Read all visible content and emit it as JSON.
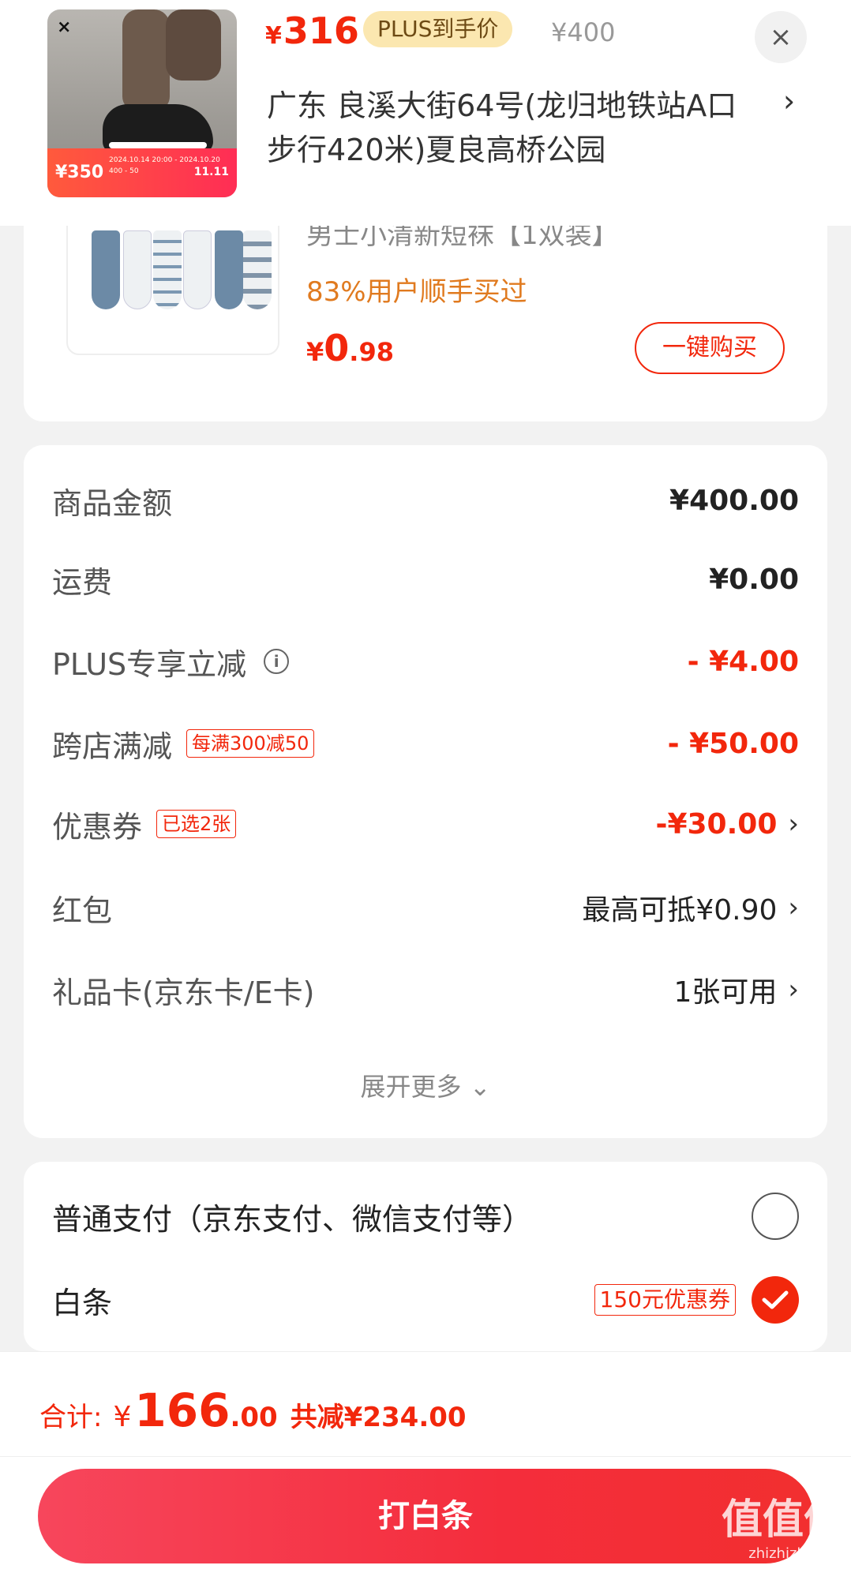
{
  "header": {
    "price_yen": "¥",
    "price_value": "316",
    "plus_tag": "PLUS到手价",
    "original_price": "¥400",
    "close_icon": "×",
    "address": "广东  良溪大街64号(龙归地铁站A口步行420米)夏良高桥公园",
    "address_chevron": "›",
    "thumb": {
      "brand_icon": "under-armour-logo",
      "promo_big": "¥350",
      "promo_mini_1": "2024.10.14 20:00 - 2024.10.20",
      "promo_mini_2": "400 - 50",
      "promo_logo": "11.11"
    }
  },
  "recommendation": {
    "title": "男士小清新短袜【1双装】",
    "subtitle": "83%用户顺手买过",
    "price_yen": "¥",
    "price_int": "0",
    "price_dec": ".98",
    "buy_button": "一键购买"
  },
  "summary": {
    "rows": [
      {
        "label": "商品金额",
        "value": "¥400.00"
      },
      {
        "label": "运费",
        "value": "¥0.00"
      },
      {
        "label": "PLUS专享立减",
        "value": "- ¥4.00",
        "info_icon": "i"
      },
      {
        "label": "跨店满减",
        "value": "- ¥50.00",
        "tag": "每满300减50"
      },
      {
        "label": "优惠券",
        "value": "-¥30.00",
        "tag": "已选2张",
        "chevron": "›"
      },
      {
        "label": "红包",
        "value": "最高可抵¥0.90",
        "chevron": "›"
      },
      {
        "label": "礼品卡(京东卡/E卡)",
        "value": "1张可用",
        "chevron": "›"
      }
    ],
    "expand_more": "展开更多",
    "expand_icon": "⌄"
  },
  "payment": {
    "options": [
      {
        "label": "普通支付（京东支付、微信支付等）",
        "selected": false
      },
      {
        "label": "白条",
        "tag": "150元优惠券",
        "selected": true
      }
    ]
  },
  "bottom": {
    "total_label": "合计:",
    "total_yen": "¥",
    "total_int": "166",
    "total_dec": ".00",
    "saved_text": "共减¥234.00",
    "pay_button": "打白条",
    "watermark": "值值值",
    "watermark_sub": "zhizhizhi.com"
  },
  "colors": {
    "accent_red": "#f2270c",
    "plus_gold_bg": "#fbe7b0",
    "recommend_orange": "#e07a1f"
  }
}
